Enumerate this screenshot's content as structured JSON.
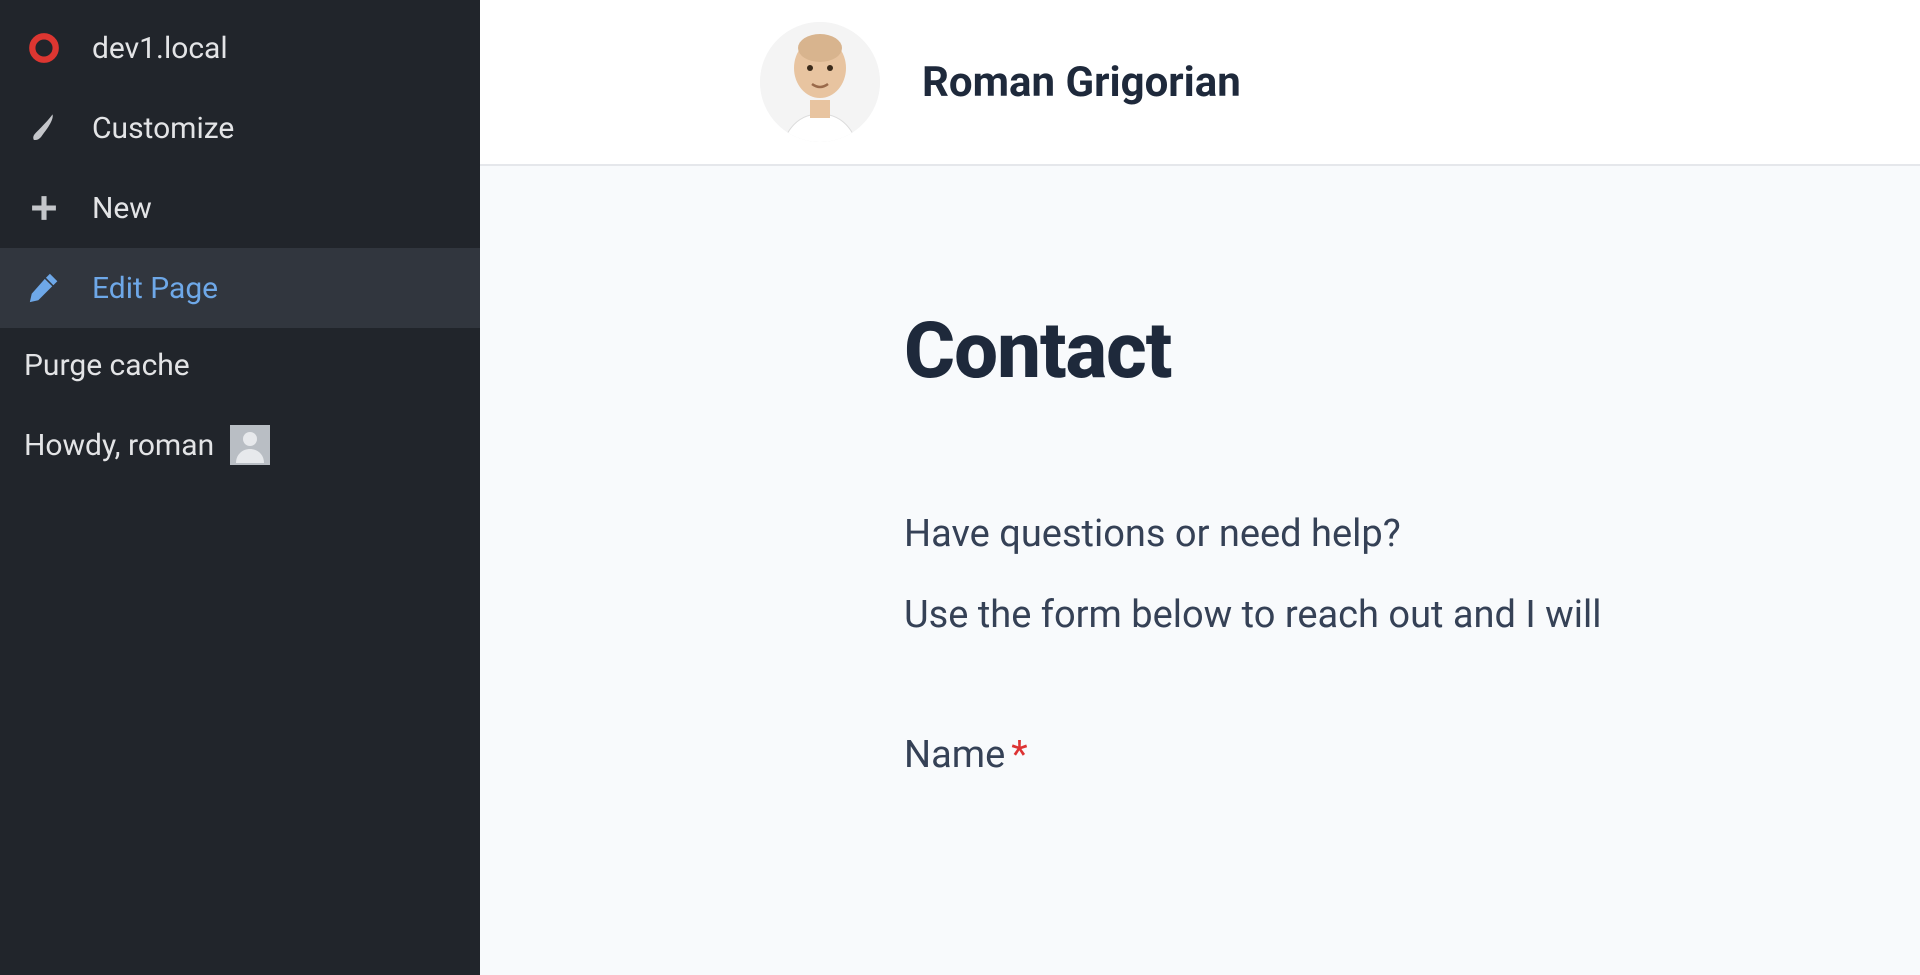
{
  "admin_bar": {
    "items": [
      {
        "label": "dev1.local",
        "icon": "ring-icon"
      },
      {
        "label": "Customize",
        "icon": "brush-icon"
      },
      {
        "label": "New",
        "icon": "plus-icon"
      },
      {
        "label": "Edit Page",
        "icon": "pencil-icon",
        "selected": true
      },
      {
        "label": "Purge cache",
        "icon": null
      }
    ],
    "howdy_prefix": "Howdy, ",
    "howdy_user": "roman"
  },
  "site": {
    "title": "Roman Grigorian"
  },
  "page": {
    "title": "Contact",
    "intro_line_1": "Have questions or need help?",
    "intro_line_2": "Use the form below to reach out and I will ",
    "form": {
      "name_label": "Name",
      "required_marker": "*"
    }
  }
}
